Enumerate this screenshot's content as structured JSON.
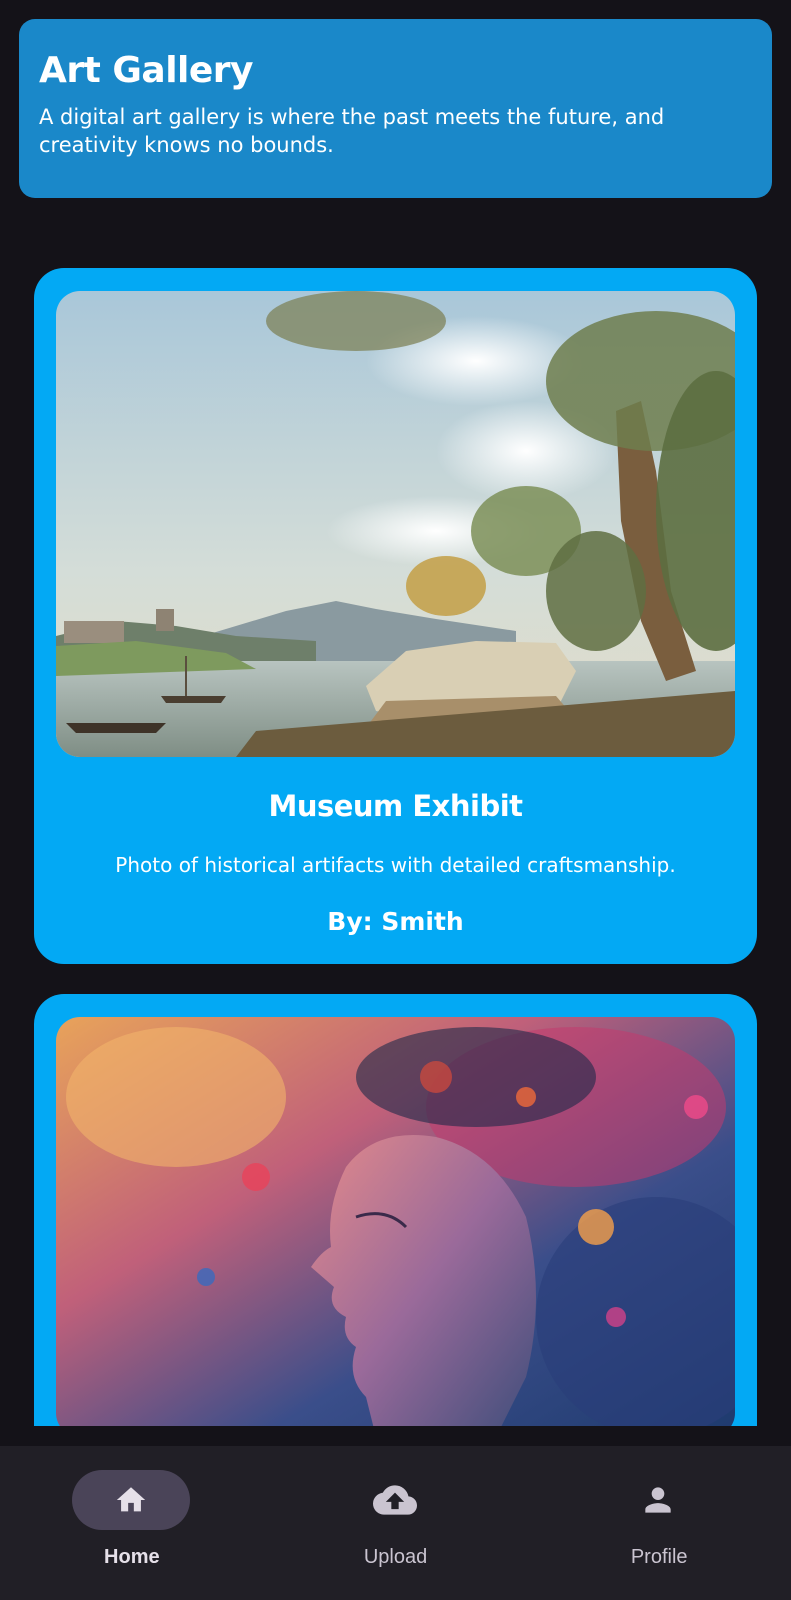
{
  "header": {
    "title": "Art Gallery",
    "description": "A digital art gallery is where the past meets the future, and creativity knows no bounds."
  },
  "artworks": [
    {
      "title": "Museum Exhibit",
      "description": "Photo of historical artifacts with detailed craftsmanship.",
      "author": "By: Smith",
      "image_icon": "landscape-painting"
    },
    {
      "image_icon": "abstract-portrait"
    }
  ],
  "bottom_nav": {
    "items": [
      {
        "label": "Home",
        "icon": "home-icon",
        "active": true
      },
      {
        "label": "Upload",
        "icon": "cloud-upload-icon",
        "active": false
      },
      {
        "label": "Profile",
        "icon": "person-icon",
        "active": false
      }
    ]
  },
  "colors": {
    "background": "#141218",
    "header": "#1A88C9",
    "card": "#03A9F4",
    "nav": "#211F26",
    "nav_indicator": "#4A4458"
  }
}
